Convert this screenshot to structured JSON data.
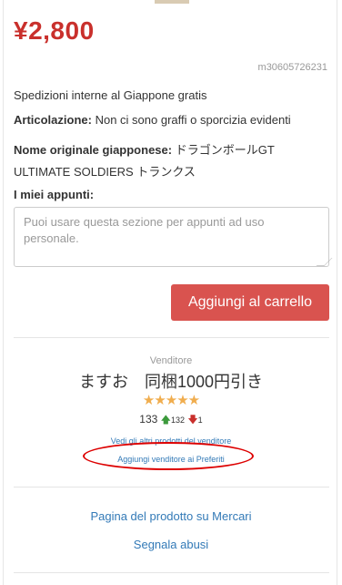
{
  "price": "¥2,800",
  "item_id": "m30605726231",
  "shipping": "Spedizioni interne al Giappone gratis",
  "condition": {
    "label": "Articolazione:",
    "value": "Non ci sono graffi o sporcizia evidenti"
  },
  "original_name": {
    "label": "Nome originale giapponese:",
    "value_line1": "ドラゴンボールGT",
    "value_line2": "ULTIMATE SOLDIERS トランクス"
  },
  "notes": {
    "label": "I miei appunti:",
    "placeholder": "Puoi usare questa sezione per appunti ad uso personale."
  },
  "cart_button": "Aggiungi al carrello",
  "seller": {
    "caption": "Venditore",
    "name": "ますお　同梱1000円引き",
    "stars": "★★★★★",
    "rating_count": 5,
    "total": "133",
    "positive": "132",
    "negative": "1",
    "other_items_link": "Vedi gli altri prodotti del venditore",
    "favorite_link": "Aggiungi venditore ai Preferiti"
  },
  "colors": {
    "price": "#c9302c",
    "button": "#d9534f",
    "link": "#337ab7",
    "annotation": "#dd0000"
  },
  "links": {
    "mercari": "Pagina del prodotto su Mercari",
    "report": "Segnala abusi"
  }
}
